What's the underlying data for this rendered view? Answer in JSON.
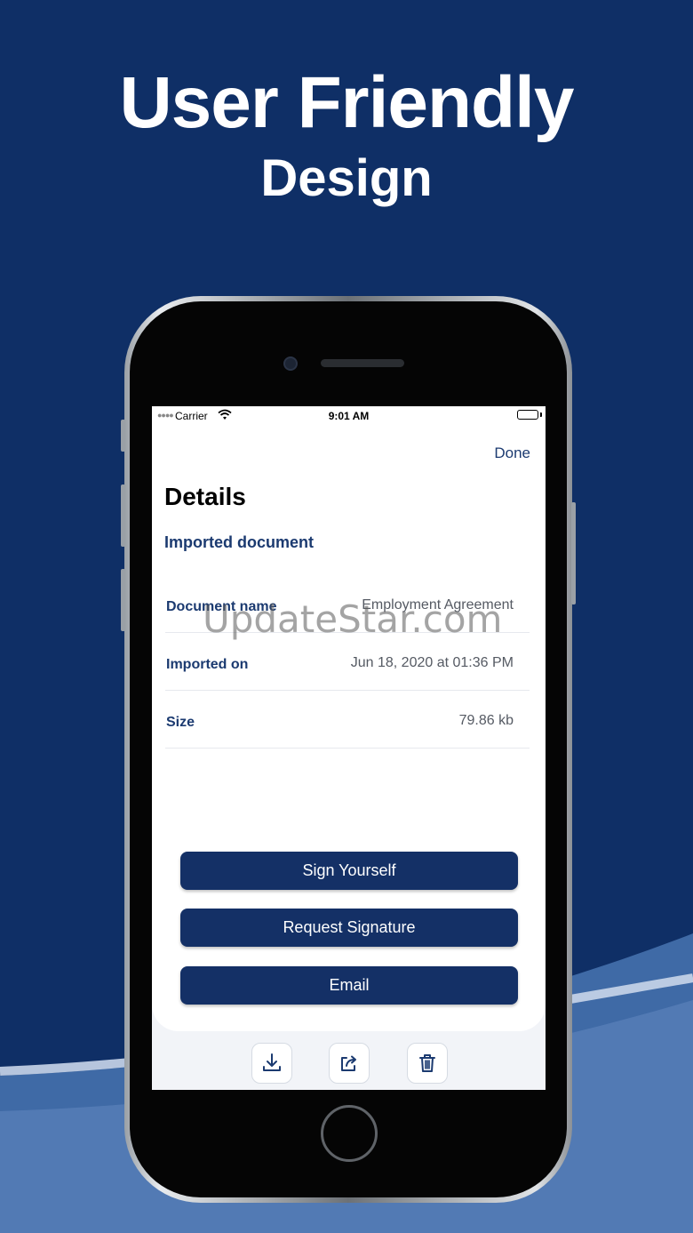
{
  "promo": {
    "headline": "User Friendly",
    "subhead": "Design"
  },
  "status_bar": {
    "carrier": "Carrier",
    "time": "9:01 AM"
  },
  "header": {
    "done_label": "Done",
    "title": "Details",
    "section": "Imported document"
  },
  "details": [
    {
      "label": "Document name",
      "value": "Employment Agreement"
    },
    {
      "label": "Imported on",
      "value": "Jun 18, 2020 at 01:36 PM"
    },
    {
      "label": "Size",
      "value": "79.86 kb"
    }
  ],
  "actions": {
    "sign_yourself": "Sign Yourself",
    "request_signature": "Request Signature",
    "email": "Email"
  },
  "toolbar": {
    "icons": [
      "download-icon",
      "share-icon",
      "trash-icon"
    ]
  },
  "watermark": "UpdateStar.com",
  "colors": {
    "background": "#0f2f66",
    "button": "#143066",
    "accent_text": "#1b3a70"
  }
}
